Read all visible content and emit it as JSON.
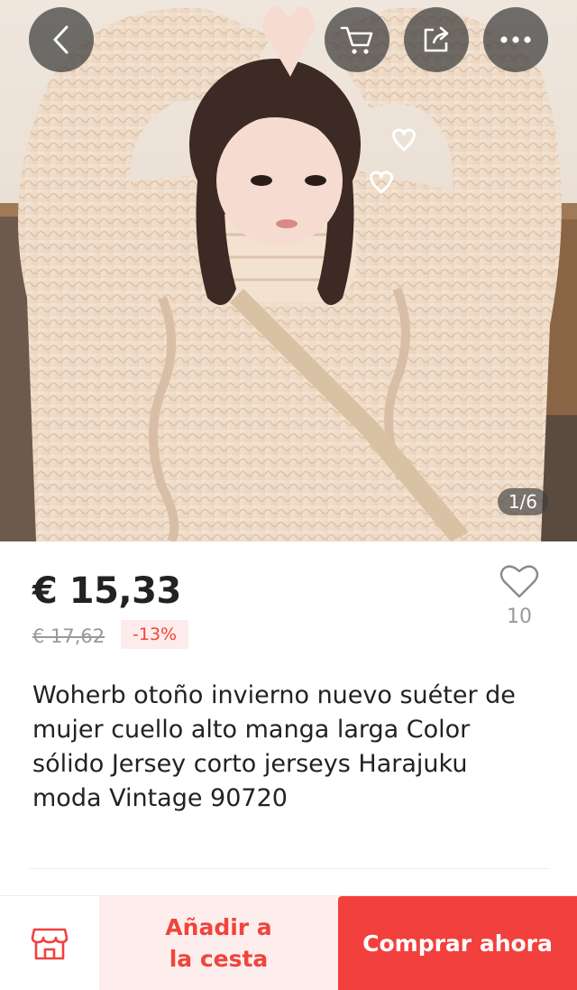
{
  "header": {
    "back_icon": "chevron-left-icon",
    "cart_icon": "cart-icon",
    "share_icon": "share-icon",
    "more_icon": "more-icon"
  },
  "gallery": {
    "counter": "1/6",
    "image_description_icon": "product-photo"
  },
  "product": {
    "price": "€ 15,33",
    "original_price": "€ 17,62",
    "discount": "-13%",
    "wishlist_count": "10",
    "title": "Woherb otoño invierno nuevo suéter de mujer cuello alto manga larga Color sólido Jersey corto jerseys Harajuku moda Vintage 90720"
  },
  "bottom_bar": {
    "store_icon": "store-icon",
    "add_to_cart_label": "Añadir a la cesta",
    "buy_now_label": "Comprar ahora"
  },
  "colors": {
    "accent": "#f2403d",
    "accent_light": "#fdeeed",
    "discount_bg": "#fdeceb",
    "price_text": "#222222",
    "muted_text": "#999999"
  }
}
